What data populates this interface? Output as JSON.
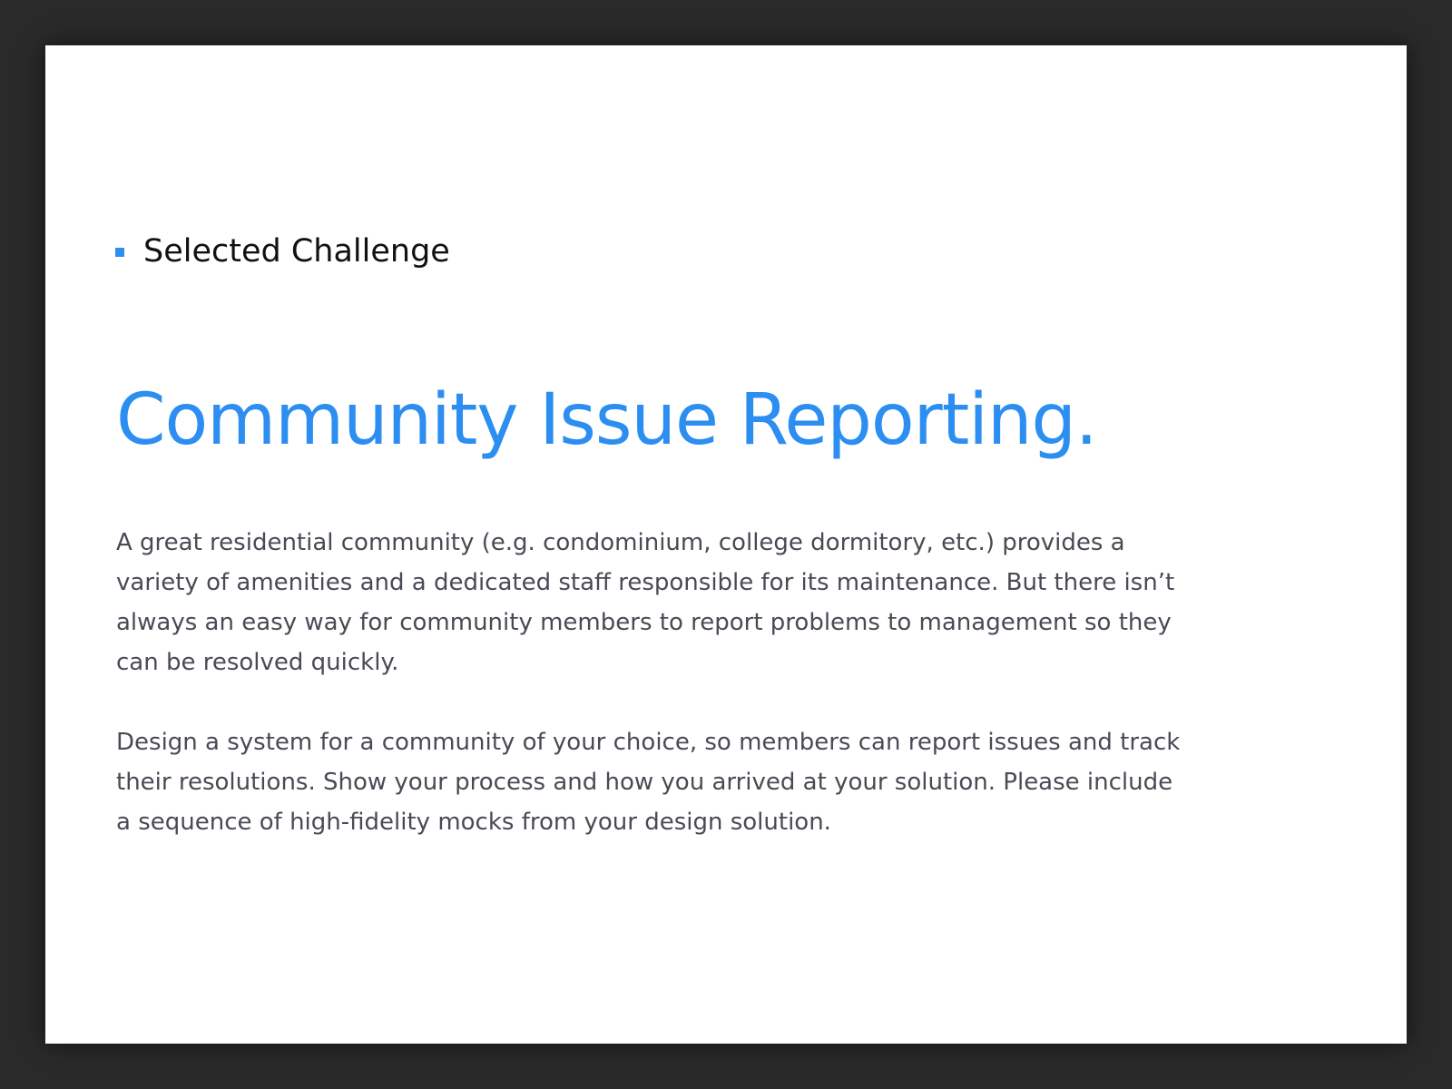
{
  "slide": {
    "section_label": "Selected Challenge",
    "title": "Community Issue Reporting.",
    "paragraphs": [
      "A great residential community (e.g. condominium, college dormitory, etc.) provides a variety of amenities and a dedicated staff responsible for its maintenance. But there isn’t always an easy way for community members to report problems to management so they can be resolved quickly.",
      "Design a system for a community of your choice, so members can report issues and track their resolutions. Show your process and how you arrived at your solution. Please include a sequence of high-fidelity mocks from your design solution."
    ]
  },
  "colors": {
    "accent": "#2b8ef0",
    "background": "#2a2a2a",
    "slide": "#ffffff",
    "body_text": "#4a4a55"
  },
  "icons": {
    "section_bullet": "square-bullet-icon"
  }
}
